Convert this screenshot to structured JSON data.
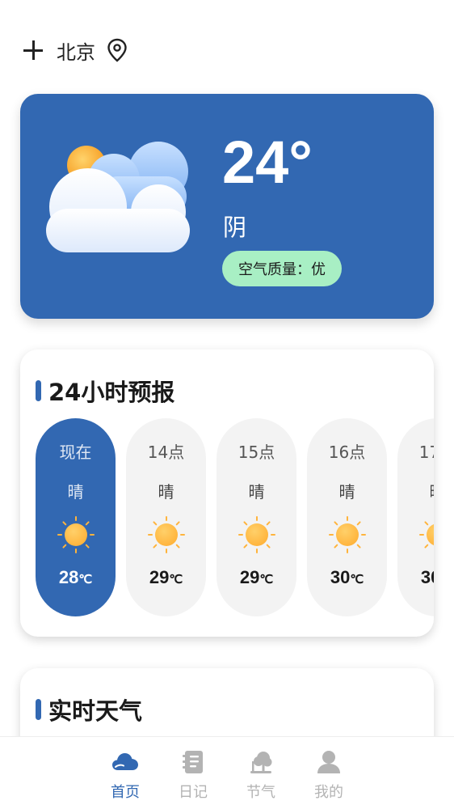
{
  "header": {
    "city": "北京",
    "add_icon": "plus-icon",
    "location_icon": "location-pin-icon"
  },
  "current": {
    "temperature": "24°",
    "condition": "阴",
    "air_quality": "空气质量：优",
    "icon": "cloud-sun-icon"
  },
  "forecast": {
    "title": "24小时预报",
    "hours": [
      {
        "time": "现在",
        "condition": "晴",
        "temp": "28",
        "unit": "℃",
        "icon": "sun-icon",
        "active": true
      },
      {
        "time": "14点",
        "condition": "晴",
        "temp": "29",
        "unit": "℃",
        "icon": "sun-icon"
      },
      {
        "time": "15点",
        "condition": "晴",
        "temp": "29",
        "unit": "℃",
        "icon": "sun-icon"
      },
      {
        "time": "16点",
        "condition": "晴",
        "temp": "30",
        "unit": "℃",
        "icon": "sun-icon"
      },
      {
        "time": "17点",
        "condition": "晴",
        "temp": "30",
        "unit": "℃",
        "icon": "sun-icon"
      }
    ]
  },
  "realtime": {
    "title": "实时天气"
  },
  "tabs": [
    {
      "label": "首页",
      "icon": "cloud-icon",
      "active": true
    },
    {
      "label": "日记",
      "icon": "notebook-icon"
    },
    {
      "label": "节气",
      "icon": "tree-icon"
    },
    {
      "label": "我的",
      "icon": "user-icon"
    }
  ],
  "colors": {
    "primary": "#3268b2",
    "air_quality_bg": "#a8efc4",
    "sun": "#ffb43c",
    "inactive": "#b3b3b3"
  }
}
